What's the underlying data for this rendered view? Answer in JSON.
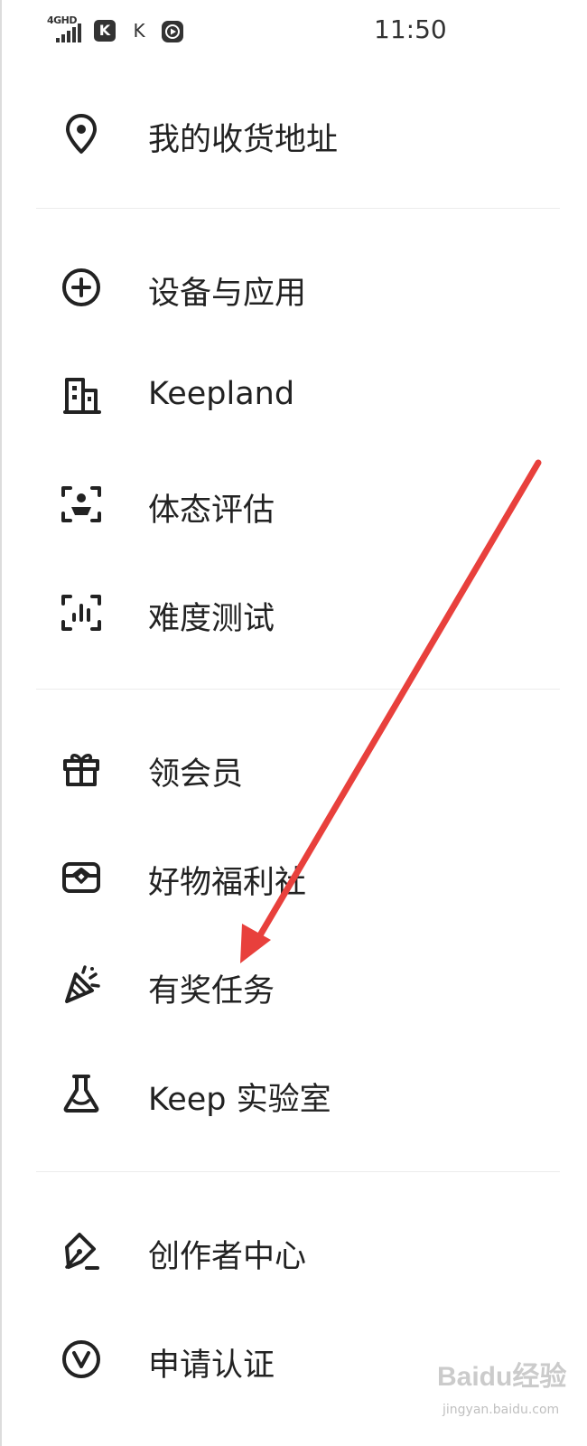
{
  "status_bar": {
    "network": "4GHD",
    "app_icon_1": "K",
    "app_icon_2": "K",
    "time": "11:50"
  },
  "menu": {
    "group1": [
      {
        "label": "我的收货地址",
        "icon": "location-pin-icon"
      }
    ],
    "group2": [
      {
        "label": "设备与应用",
        "icon": "add-circle-icon"
      },
      {
        "label": "Keepland",
        "icon": "building-icon"
      },
      {
        "label": "体态评估",
        "icon": "body-scan-icon"
      },
      {
        "label": "难度测试",
        "icon": "level-test-icon"
      }
    ],
    "group3": [
      {
        "label": "领会员",
        "icon": "gift-icon"
      },
      {
        "label": "好物福利社",
        "icon": "shop-box-icon"
      },
      {
        "label": "有奖任务",
        "icon": "party-popper-icon"
      },
      {
        "label": "Keep 实验室",
        "icon": "flask-icon"
      }
    ],
    "group4": [
      {
        "label": "创作者中心",
        "icon": "pen-edit-icon"
      },
      {
        "label": "申请认证",
        "icon": "verified-v-icon"
      }
    ]
  },
  "annotation": {
    "arrow_color": "#e8403c"
  },
  "watermark": {
    "brand": "Baidu经验",
    "sub": "jingyan.baidu.com"
  }
}
